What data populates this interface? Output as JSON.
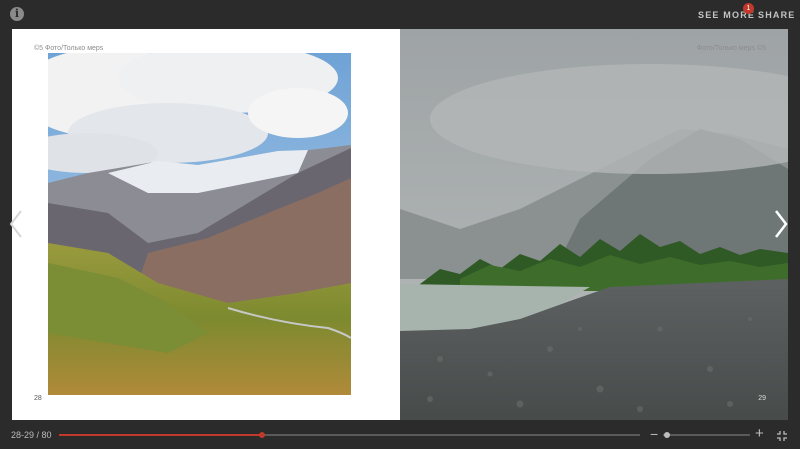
{
  "topbar": {
    "see_more_label": "SEE MORE",
    "share_label": "SHARE",
    "notification_count": "1",
    "info_icon": "i"
  },
  "left_page": {
    "header": "©5  Фото/Только мерs",
    "page_number": "28",
    "photo": "mountain valley with glacier and green slopes"
  },
  "right_page": {
    "header": "Фото/Только мерs  ©5",
    "page_number": "29",
    "photo": "misty mountains, forest, lake and pebble shore"
  },
  "navigation": {
    "prev_icon": "chevron-left-icon",
    "next_icon": "chevron-right-icon"
  },
  "bottombar": {
    "page_counter": "28-29 / 80",
    "progress": 0.35,
    "zoom_level": 0.05,
    "zoom_minus": "−",
    "zoom_plus": "+"
  },
  "colors": {
    "background": "#2b2b2b",
    "accent": "#c0392b",
    "page": "#ffffff"
  }
}
